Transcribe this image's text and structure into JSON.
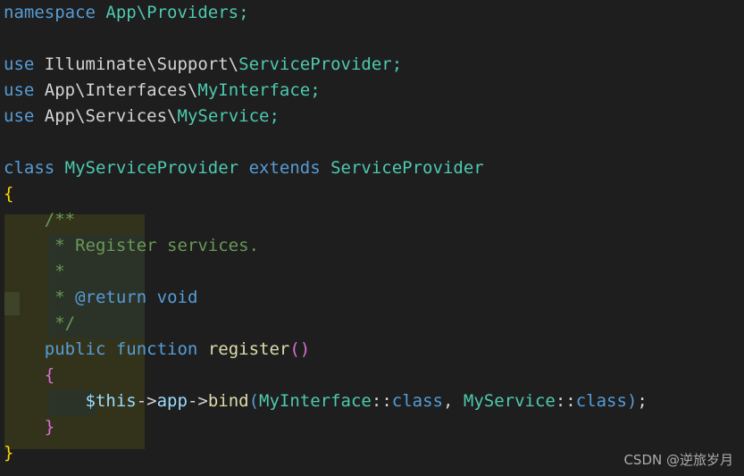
{
  "editor": {
    "language": "php",
    "background_color": "#1e1e1e",
    "font_size_px": 19,
    "line_height_px": 29,
    "theme": "Dark+ (VS Code dark)"
  },
  "colors": {
    "keyword": "#569cd6",
    "class_name": "#4ec9b0",
    "plain_text": "#d4d4d4",
    "function_name": "#dcdcaa",
    "variable": "#9cdcfe",
    "comment": "#6a9955",
    "brace_yellow": "#ffd700",
    "brace_magenta": "#da70d6",
    "scope_highlight_outer": "#33331c",
    "scope_highlight_inner": "#2b3328",
    "scope_highlight_bright": "#3d4428"
  },
  "code": {
    "lines": [
      {
        "n": 1,
        "text": "namespace App\\Providers;"
      },
      {
        "n": 2,
        "text": ""
      },
      {
        "n": 3,
        "text": "use Illuminate\\Support\\ServiceProvider;"
      },
      {
        "n": 4,
        "text": "use App\\Interfaces\\MyInterface;"
      },
      {
        "n": 5,
        "text": "use App\\Services\\MyService;"
      },
      {
        "n": 6,
        "text": ""
      },
      {
        "n": 7,
        "text": "class MyServiceProvider extends ServiceProvider"
      },
      {
        "n": 8,
        "text": "{"
      },
      {
        "n": 9,
        "text": "    /**"
      },
      {
        "n": 10,
        "text": "     * Register services."
      },
      {
        "n": 11,
        "text": "     *"
      },
      {
        "n": 12,
        "text": "     * @return void"
      },
      {
        "n": 13,
        "text": "     */"
      },
      {
        "n": 14,
        "text": "    public function register()"
      },
      {
        "n": 15,
        "text": "    {"
      },
      {
        "n": 16,
        "text": "        $this->app->bind(MyInterface::class, MyService::class);"
      },
      {
        "n": 17,
        "text": "    }"
      },
      {
        "n": 18,
        "text": "}"
      }
    ],
    "tokens": {
      "kw_namespace": "namespace",
      "ns_app_providers": "App\\Providers",
      "kw_use": "use",
      "import_illuminate_support": "Illuminate\\Support\\",
      "import_service_provider": "ServiceProvider",
      "import_app_interfaces": "App\\Interfaces\\",
      "import_my_interface": "MyInterface",
      "import_app_services": "App\\Services\\",
      "import_my_service": "MyService",
      "kw_class": "class",
      "class_name_main": "MyServiceProvider",
      "kw_extends": "extends",
      "class_name_parent": "ServiceProvider",
      "comment_open": "/**",
      "comment_star": "*",
      "comment_register_services": "* Register services.",
      "comment_doc_tag": "@return",
      "comment_doc_type": "void",
      "comment_close": "*/",
      "kw_public": "public",
      "kw_function": "function",
      "fn_register": "register",
      "var_this": "$this",
      "prop_app": "app",
      "fn_bind": "bind",
      "const_my_interface": "MyInterface",
      "const_my_service": "MyService",
      "kw_class_const": "class",
      "semicolon": ";",
      "arrow": "->",
      "double_colon": "::",
      "comma": ",",
      "paren_open": "(",
      "paren_close": ")",
      "empty_parens": "()",
      "brace_open": "{",
      "brace_close": "}",
      "star_glyph": "*",
      "star_slash": "/"
    }
  },
  "watermark": {
    "text": "CSDN @逆旅岁月"
  }
}
